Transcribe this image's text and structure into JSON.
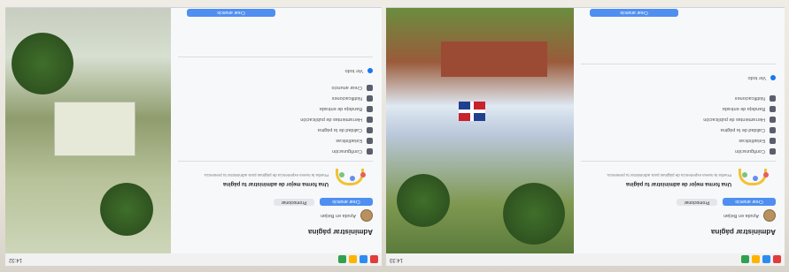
{
  "screens": [
    {
      "id": "left",
      "taskbar": {
        "time": "14:32"
      },
      "sidebar": {
        "title": "Administrar página",
        "page_name": "Ayuda en Beijan",
        "primary_button": "Crear anuncio",
        "secondary_button": "Promocionar",
        "menu_items": [
          {
            "label": "Configuración",
            "icon": "gear-icon"
          },
          {
            "label": "Estadísticas",
            "icon": "chart-icon"
          },
          {
            "label": "Calidad de la página",
            "icon": "shield-icon"
          },
          {
            "label": "Herramientas de publicación",
            "icon": "pencil-icon"
          },
          {
            "label": "Bandeja de entrada",
            "icon": "message-icon"
          },
          {
            "label": "Notificaciones",
            "icon": "bell-icon"
          },
          {
            "label": "Crear anuncio",
            "icon": "megaphone-icon"
          }
        ],
        "card": {
          "title": "Una forma mejor de administrar tu página",
          "description": "Prueba la nueva experiencia de páginas para administrar tu presencia."
        },
        "footer_link": "Ver todo"
      }
    },
    {
      "id": "right",
      "taskbar": {
        "time": "14:33"
      },
      "sidebar": {
        "title": "Administrar página",
        "page_name": "Ayuda en Beijan",
        "primary_button": "Crear anuncio",
        "secondary_button": "Promocionar",
        "menu_items": [
          {
            "label": "Configuración",
            "icon": "gear-icon"
          },
          {
            "label": "Estadísticas",
            "icon": "chart-icon"
          },
          {
            "label": "Calidad de la página",
            "icon": "shield-icon"
          },
          {
            "label": "Herramientas de publicación",
            "icon": "pencil-icon"
          },
          {
            "label": "Bandeja de entrada",
            "icon": "message-icon"
          },
          {
            "label": "Notificaciones",
            "icon": "bell-icon"
          }
        ],
        "card": {
          "title": "Una forma mejor de administrar tu página",
          "description": "Prueba la nueva experiencia de páginas para administrar tu presencia."
        },
        "footer_link": "Ver todo"
      }
    }
  ],
  "colors": {
    "accent": "#1877f2",
    "button": "#4f8ff0",
    "flag_blue": "#1f3f8f",
    "flag_red": "#c8222b"
  }
}
